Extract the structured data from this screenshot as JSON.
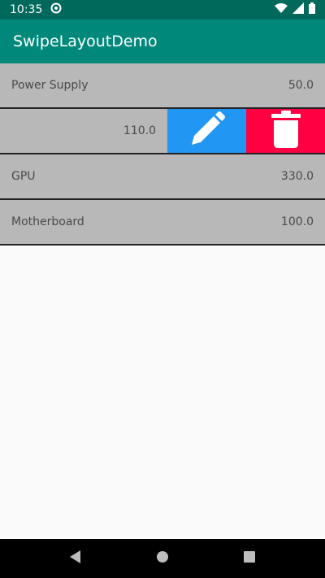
{
  "status_bar": {
    "time": "10:35"
  },
  "app_bar": {
    "title": "SwipeLayoutDemo"
  },
  "items": [
    {
      "name": "Power Supply",
      "price": "50.0"
    },
    {
      "name": "",
      "price": "110.0",
      "swiped": true
    },
    {
      "name": "GPU",
      "price": "330.0"
    },
    {
      "name": "Motherboard",
      "price": "100.0"
    }
  ],
  "colors": {
    "status_bar": "#00695c",
    "app_bar": "#00897b",
    "row": "#b8b8b8",
    "edit": "#2196f3",
    "delete": "#ff0042"
  },
  "icons": [
    "edit-pencil-icon",
    "trash-icon",
    "wifi-icon",
    "signal-icon",
    "battery-icon",
    "back-icon",
    "home-icon",
    "recents-icon"
  ]
}
